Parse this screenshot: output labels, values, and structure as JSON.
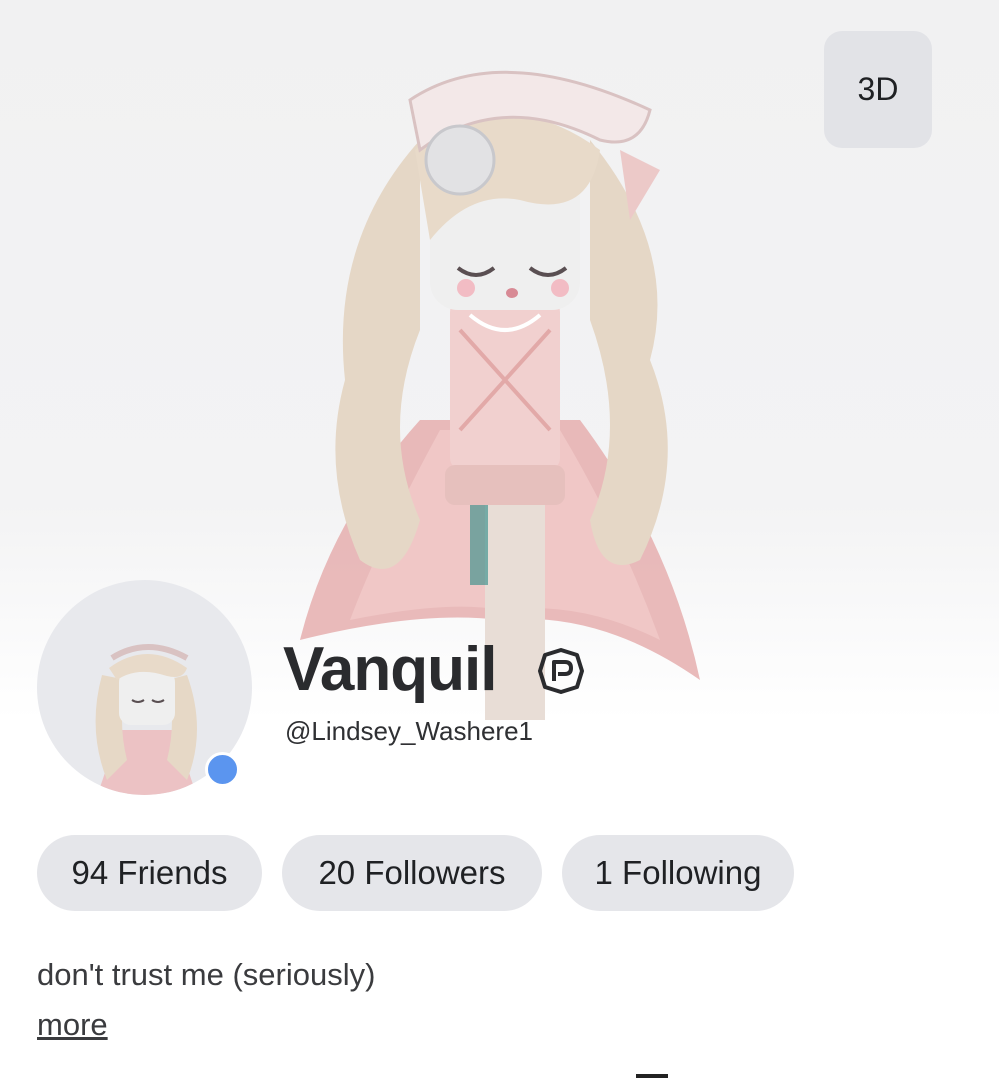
{
  "hero": {
    "avatar_image": "full-body avatar render",
    "view_toggle_label": "3D"
  },
  "profile": {
    "display_name": "Vanquil",
    "username": "@Lindsey_Washere1",
    "online_status_color": "#5b95ef",
    "premium_icon": "premium-badge-icon"
  },
  "stats": {
    "friends_label": "94 Friends",
    "followers_label": "20 Followers",
    "following_label": "1 Following"
  },
  "about": {
    "bio": "don't trust me (seriously)",
    "more_label": "more"
  }
}
